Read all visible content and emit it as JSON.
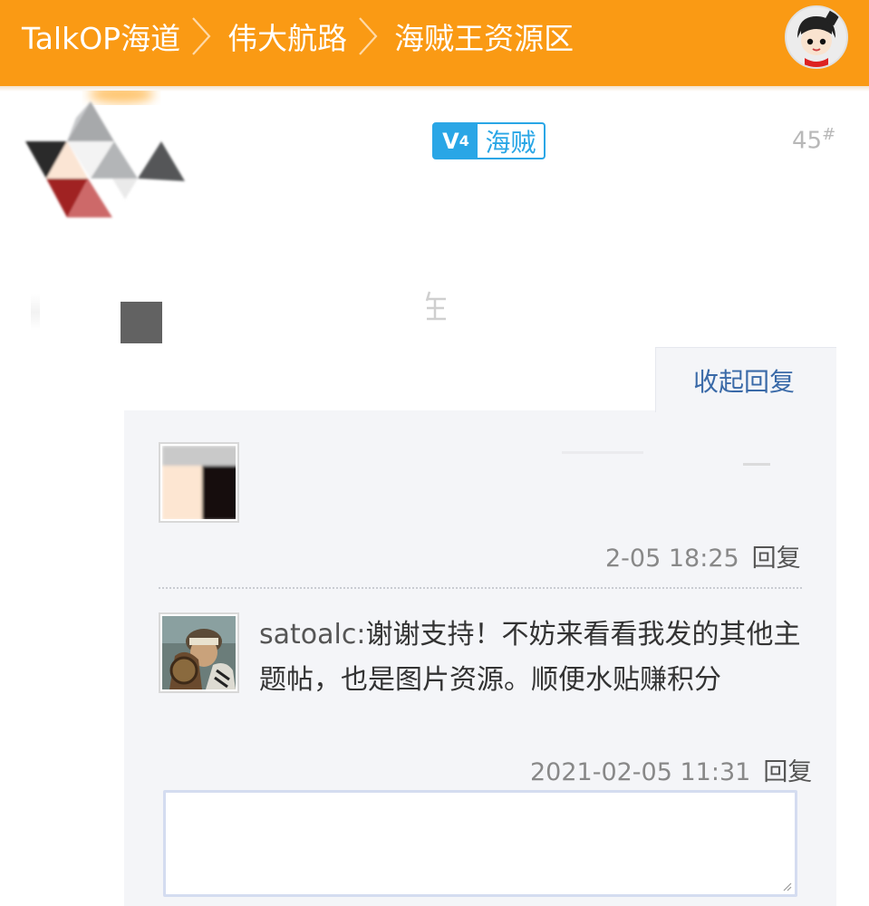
{
  "header": {
    "breadcrumbs": [
      "TalkOP海道",
      "伟大航路",
      "海贼王资源区"
    ],
    "bg_color": "#fa9a14"
  },
  "post": {
    "badge_prefix": "V",
    "badge_level": "4",
    "badge_label": "海贼",
    "floor_number": "45",
    "floor_mark": "#",
    "collapse_label": "收起回复"
  },
  "replies": [
    {
      "date": "2-05 18:25",
      "reply_label": "回复"
    },
    {
      "user": "satoalc:",
      "text": "谢谢支持！不妨来看看我发的其他主题帖，也是图片资源。顺便水贴赚积分",
      "date": "2021-02-05 11:31",
      "reply_label": "回复"
    }
  ],
  "input": {
    "placeholder": ""
  }
}
